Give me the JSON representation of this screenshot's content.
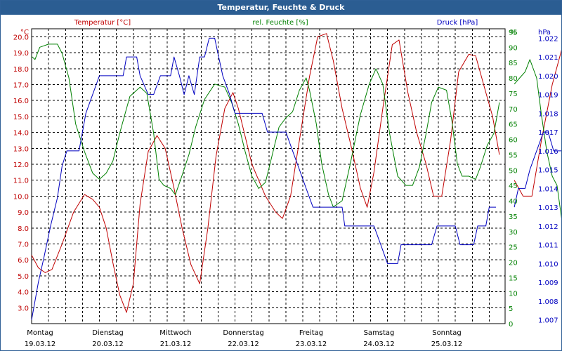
{
  "window": {
    "title": "Temperatur, Feuchte & Druck"
  },
  "chart_data": {
    "type": "line",
    "title": "Temperatur, Feuchte & Druck",
    "x_categories": [
      {
        "day": "Montag",
        "date": "19.03.12"
      },
      {
        "day": "Dienstag",
        "date": "20.03.12"
      },
      {
        "day": "Mittwoch",
        "date": "21.03.12"
      },
      {
        "day": "Donnerstag",
        "date": "22.03.12"
      },
      {
        "day": "Freitag",
        "date": "23.03.12"
      },
      {
        "day": "Samstag",
        "date": "24.03.12"
      },
      {
        "day": "Sonntag",
        "date": "25.03.12"
      }
    ],
    "x_range_days": [
      0,
      7
    ],
    "grid": true,
    "axes": {
      "temperature": {
        "label": "Temperatur [°C]",
        "unit": "°C",
        "color": "#c00000",
        "side": "left",
        "range": [
          2.0,
          20.5
        ],
        "ticks": [
          "3.0",
          "4.0",
          "5.0",
          "6.0",
          "7.0",
          "8.0",
          "9.0",
          "10.0",
          "11.0",
          "12.0",
          "13.0",
          "14.0",
          "15.0",
          "16.0",
          "17.0",
          "18.0",
          "19.0",
          "20.0"
        ]
      },
      "humidity": {
        "label": "rel. Feuchte [%]",
        "unit": "%",
        "color": "#008000",
        "side": "right-inner",
        "range": [
          0,
          96
        ],
        "ticks": [
          "0",
          "5",
          "10",
          "15",
          "20",
          "25",
          "30",
          "35",
          "40",
          "45",
          "50",
          "55",
          "60",
          "65",
          "70",
          "75",
          "80",
          "85",
          "90",
          "95"
        ]
      },
      "pressure": {
        "label": "Druck [hPa]",
        "unit": "hPa",
        "color": "#0000c0",
        "side": "right-outer",
        "range": [
          1.0068,
          1.0225
        ],
        "ticks": [
          "1.007",
          "1.008",
          "1.009",
          "1.010",
          "1.011",
          "1.012",
          "1.013",
          "1.014",
          "1.015",
          "1.016",
          "1.017",
          "1.018",
          "1.019",
          "1.020",
          "1.021",
          "1.022"
        ]
      }
    },
    "series": [
      {
        "name": "Temperatur [°C]",
        "axis": "temperature",
        "color": "#c00000",
        "segments": [
          [
            [
              0.0,
              6.3
            ],
            [
              0.1,
              5.5
            ],
            [
              0.2,
              5.2
            ],
            [
              0.3,
              5.4
            ],
            [
              0.45,
              7.0
            ],
            [
              0.62,
              9.0
            ],
            [
              0.78,
              10.1
            ],
            [
              0.9,
              9.8
            ],
            [
              1.0,
              9.3
            ],
            [
              1.1,
              8.0
            ],
            [
              1.2,
              5.8
            ],
            [
              1.3,
              3.8
            ],
            [
              1.4,
              2.7
            ],
            [
              1.5,
              4.5
            ],
            [
              1.6,
              9.5
            ],
            [
              1.72,
              12.8
            ],
            [
              1.85,
              13.8
            ],
            [
              1.97,
              13.0
            ],
            [
              2.1,
              10.5
            ],
            [
              2.22,
              8.0
            ],
            [
              2.35,
              5.7
            ],
            [
              2.48,
              4.5
            ],
            [
              2.6,
              8.0
            ],
            [
              2.72,
              12.5
            ],
            [
              2.85,
              15.5
            ],
            [
              2.97,
              16.5
            ],
            [
              3.05,
              15.5
            ],
            [
              3.25,
              12.0
            ],
            [
              3.45,
              10.0
            ],
            [
              3.6,
              9.0
            ],
            [
              3.7,
              8.6
            ],
            [
              3.82,
              10.0
            ],
            [
              3.95,
              13.5
            ],
            [
              4.1,
              17.5
            ],
            [
              4.22,
              20.0
            ],
            [
              4.35,
              20.2
            ],
            [
              4.45,
              18.5
            ],
            [
              4.58,
              15.5
            ],
            [
              4.72,
              13.0
            ],
            [
              4.85,
              10.5
            ],
            [
              4.95,
              9.3
            ],
            [
              5.05,
              11.5
            ],
            [
              5.18,
              15.5
            ],
            [
              5.32,
              19.5
            ],
            [
              5.42,
              19.8
            ],
            [
              5.55,
              16.5
            ],
            [
              5.68,
              14.0
            ],
            [
              5.82,
              12.0
            ],
            [
              5.93,
              10.0
            ],
            [
              6.05,
              10.0
            ],
            [
              6.18,
              13.5
            ],
            [
              6.3,
              17.8
            ],
            [
              6.45,
              18.9
            ],
            [
              6.55,
              18.8
            ],
            [
              6.7,
              16.5
            ],
            [
              6.8,
              15.0
            ],
            [
              6.9,
              12.6
            ]
          ],
          [
            [
              7.12,
              11.0
            ],
            [
              7.25,
              10.0
            ],
            [
              7.38,
              10.0
            ],
            [
              7.52,
              13.5
            ],
            [
              7.68,
              17.0
            ],
            [
              7.82,
              19.2
            ],
            [
              7.9,
              19.6
            ],
            [
              7.98,
              18.0
            ],
            [
              8.06,
              15.5
            ],
            [
              8.12,
              13.6
            ]
          ]
        ]
      },
      {
        "name": "rel. Feuchte [%]",
        "axis": "humidity",
        "color": "#008000",
        "segments": [
          [
            [
              0.0,
              87
            ],
            [
              0.05,
              86
            ],
            [
              0.12,
              90
            ],
            [
              0.25,
              91
            ],
            [
              0.38,
              91
            ],
            [
              0.45,
              88
            ],
            [
              0.55,
              80
            ],
            [
              0.65,
              65
            ],
            [
              0.78,
              56
            ],
            [
              0.9,
              49
            ],
            [
              1.0,
              47
            ],
            [
              1.1,
              49
            ],
            [
              1.2,
              53
            ],
            [
              1.3,
              62
            ],
            [
              1.45,
              74
            ],
            [
              1.6,
              77
            ],
            [
              1.7,
              75
            ],
            [
              1.8,
              62
            ],
            [
              1.88,
              47
            ],
            [
              1.95,
              45
            ],
            [
              2.05,
              44
            ],
            [
              2.12,
              42
            ],
            [
              2.2,
              47
            ],
            [
              2.32,
              55
            ],
            [
              2.42,
              64
            ],
            [
              2.55,
              73
            ],
            [
              2.7,
              78
            ],
            [
              2.85,
              77
            ],
            [
              2.95,
              72
            ],
            [
              3.05,
              65
            ],
            [
              3.15,
              56
            ],
            [
              3.25,
              48
            ],
            [
              3.35,
              44
            ],
            [
              3.45,
              46
            ],
            [
              3.55,
              55
            ],
            [
              3.65,
              64
            ],
            [
              3.75,
              67
            ],
            [
              3.85,
              69
            ],
            [
              3.95,
              76
            ],
            [
              4.05,
              80
            ],
            [
              4.1,
              76
            ],
            [
              4.2,
              65
            ],
            [
              4.28,
              52
            ],
            [
              4.38,
              42
            ],
            [
              4.45,
              38
            ],
            [
              4.58,
              40
            ],
            [
              4.7,
              52
            ],
            [
              4.85,
              68
            ],
            [
              4.98,
              78
            ],
            [
              5.08,
              83
            ],
            [
              5.18,
              78
            ],
            [
              5.28,
              62
            ],
            [
              5.4,
              48
            ],
            [
              5.52,
              45
            ],
            [
              5.62,
              45
            ],
            [
              5.72,
              51
            ],
            [
              5.82,
              62
            ],
            [
              5.9,
              72
            ],
            [
              6.0,
              77
            ],
            [
              6.12,
              76
            ],
            [
              6.2,
              66
            ],
            [
              6.28,
              52
            ],
            [
              6.35,
              48
            ],
            [
              6.45,
              48
            ],
            [
              6.55,
              47
            ],
            [
              6.62,
              51
            ],
            [
              6.72,
              58
            ],
            [
              6.82,
              62
            ],
            [
              6.9,
              72
            ]
          ],
          [
            [
              7.12,
              78
            ],
            [
              7.2,
              80
            ],
            [
              7.28,
              82
            ],
            [
              7.35,
              86
            ],
            [
              7.45,
              80
            ],
            [
              7.52,
              68
            ],
            [
              7.6,
              56
            ],
            [
              7.68,
              48
            ],
            [
              7.75,
              45
            ],
            [
              7.82,
              34
            ],
            [
              7.88,
              32
            ],
            [
              7.95,
              35
            ],
            [
              8.05,
              38
            ],
            [
              8.12,
              40
            ]
          ]
        ]
      },
      {
        "name": "Druck [hPa]",
        "axis": "pressure",
        "color": "#0000c0",
        "segments": [
          [
            [
              0.0,
              1.007
            ],
            [
              0.05,
              1.008
            ],
            [
              0.1,
              1.009
            ],
            [
              0.18,
              1.0103
            ],
            [
              0.28,
              1.012
            ],
            [
              0.38,
              1.0135
            ],
            [
              0.45,
              1.0152
            ],
            [
              0.52,
              1.016
            ],
            [
              0.58,
              1.016
            ],
            [
              0.7,
              1.016
            ],
            [
              0.75,
              1.017
            ],
            [
              0.8,
              1.018
            ],
            [
              0.9,
              1.019
            ],
            [
              1.0,
              1.02
            ],
            [
              1.1,
              1.02
            ],
            [
              1.2,
              1.02
            ],
            [
              1.35,
              1.02
            ],
            [
              1.4,
              1.021
            ],
            [
              1.55,
              1.021
            ],
            [
              1.6,
              1.02
            ],
            [
              1.72,
              1.019
            ],
            [
              1.8,
              1.019
            ],
            [
              1.9,
              1.02
            ],
            [
              2.05,
              1.02
            ],
            [
              2.1,
              1.021
            ],
            [
              2.18,
              1.02
            ],
            [
              2.25,
              1.019
            ],
            [
              2.32,
              1.02
            ],
            [
              2.4,
              1.019
            ],
            [
              2.48,
              1.021
            ],
            [
              2.55,
              1.021
            ],
            [
              2.62,
              1.022
            ],
            [
              2.7,
              1.022
            ],
            [
              2.76,
              1.021
            ],
            [
              2.82,
              1.02
            ],
            [
              2.92,
              1.019
            ],
            [
              3.0,
              1.018
            ],
            [
              3.4,
              1.018
            ],
            [
              3.48,
              1.017
            ],
            [
              3.75,
              1.017
            ],
            [
              3.85,
              1.016
            ],
            [
              3.95,
              1.015
            ],
            [
              4.05,
              1.014
            ],
            [
              4.15,
              1.013
            ],
            [
              4.58,
              1.013
            ],
            [
              4.62,
              1.012
            ],
            [
              5.05,
              1.012
            ],
            [
              5.15,
              1.011
            ],
            [
              5.25,
              1.01
            ],
            [
              5.4,
              1.01
            ],
            [
              5.45,
              1.011
            ],
            [
              5.9,
              1.011
            ],
            [
              5.98,
              1.012
            ],
            [
              6.25,
              1.012
            ],
            [
              6.32,
              1.011
            ],
            [
              6.52,
              1.011
            ],
            [
              6.58,
              1.012
            ],
            [
              6.7,
              1.012
            ],
            [
              6.75,
              1.013
            ],
            [
              6.85,
              1.013
            ]
          ],
          [
            [
              7.12,
              1.013
            ],
            [
              7.18,
              1.014
            ],
            [
              7.28,
              1.014
            ],
            [
              7.35,
              1.015
            ],
            [
              7.45,
              1.016
            ],
            [
              7.55,
              1.017
            ],
            [
              7.62,
              1.017
            ],
            [
              7.7,
              1.016
            ],
            [
              7.82,
              1.016
            ],
            [
              7.9,
              1.017
            ],
            [
              8.0,
              1.018
            ],
            [
              8.08,
              1.018
            ]
          ]
        ]
      }
    ]
  }
}
